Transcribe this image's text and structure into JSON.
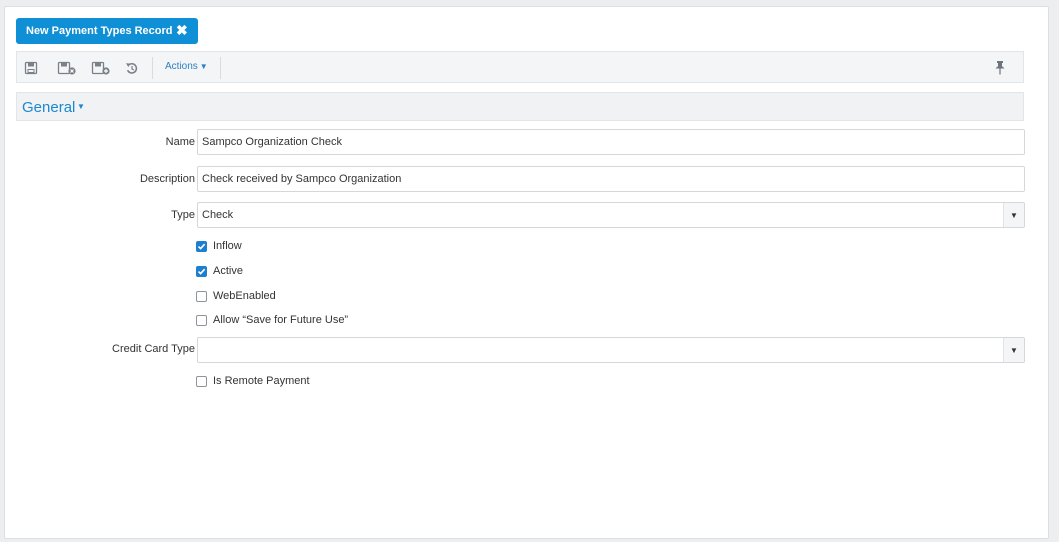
{
  "tab": {
    "label": "New Payment Types Record",
    "close_glyph": "✖"
  },
  "toolbar": {
    "icons": [
      "save-icon",
      "save-close-icon",
      "save-new-icon",
      "undo-icon"
    ],
    "actions_label": "Actions",
    "pin_icon": "pin-icon"
  },
  "section": {
    "title": "General"
  },
  "form": {
    "name": {
      "label": "Name",
      "value": "Sampco Organization Check"
    },
    "description": {
      "label": "Description",
      "value": "Check received by Sampco Organization"
    },
    "type": {
      "label": "Type",
      "value": "Check"
    },
    "checkboxes": [
      {
        "label": "Inflow",
        "checked": true
      },
      {
        "label": "Active",
        "checked": true
      },
      {
        "label": "WebEnabled",
        "checked": false
      },
      {
        "label": "Allow “Save for Future Use”",
        "checked": false
      }
    ],
    "credit_card_type": {
      "label": "Credit Card Type",
      "value": ""
    },
    "remote_payment": {
      "label": "Is Remote Payment",
      "checked": false
    }
  },
  "colors": {
    "accent": "#0f8fd6",
    "link": "#1d87cf",
    "checkbox": "#1f7fcf"
  }
}
